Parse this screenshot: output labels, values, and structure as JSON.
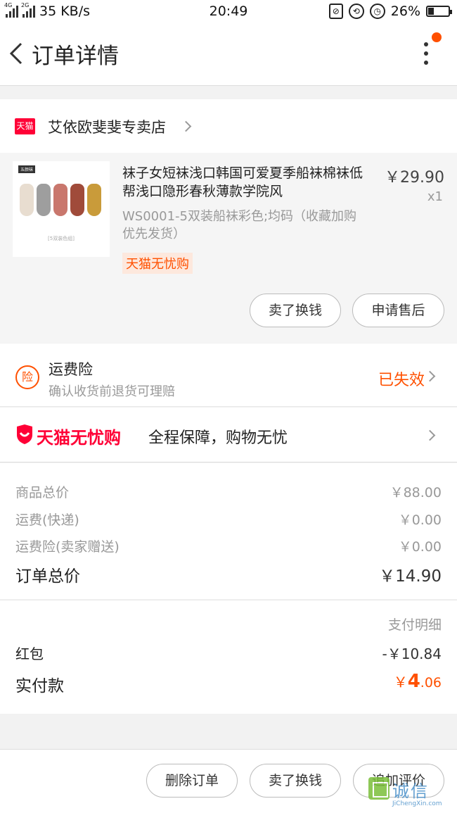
{
  "status_bar": {
    "network_speed": "35 KB/s",
    "net1": "4G",
    "net2": "2G",
    "time": "20:49",
    "battery": "26%",
    "battery_level": 0.26,
    "icons": [
      "mute-icon",
      "rotation-lock-icon",
      "alarm-icon",
      "battery-icon"
    ]
  },
  "nav": {
    "title": "订单详情",
    "back_icon": "chevron-left-icon",
    "more_icon": "more-vertical-icon",
    "notification_dot_color": "#ff5000"
  },
  "store": {
    "badge": "天猫",
    "name": "艾依欧斐斐专卖店"
  },
  "product": {
    "title": "袜子女短袜浅口韩国可爱夏季船袜棉袜低帮浅口隐形春秋薄款学院风",
    "sku": "WS0001-5双装船袜彩色;均码（收藏加购优先发货）",
    "tag": "天猫无忧购",
    "price": "￥29.90",
    "quantity": "x1",
    "thumb_label": "五颜袜",
    "thumb_caption": "[5双装色组]",
    "sock_colors": [
      "#e8ddd0",
      "#9e9e9e",
      "#c9776d",
      "#a04b3a",
      "#c99b3a"
    ]
  },
  "product_actions": {
    "resell": "卖了换钱",
    "after_sale": "申请售后"
  },
  "insurance": {
    "icon_text": "险",
    "title": "运费险",
    "desc": "确认收货前退货可理赔",
    "status": "已失效"
  },
  "worry_free": {
    "brand": "天猫无忧购",
    "slogan": "全程保障，购物无忧"
  },
  "summary": {
    "goods_total_label": "商品总价",
    "goods_total": "￥88.00",
    "shipping_label": "运费(快递)",
    "shipping": "￥0.00",
    "shipping_ins_label": "运费险(卖家赠送)",
    "shipping_ins": "￥0.00",
    "order_total_label": "订单总价",
    "order_total": "￥14.90"
  },
  "payment": {
    "detail_link": "支付明细",
    "red_packet_label": "红包",
    "red_packet": "-￥10.84",
    "paid_label": "实付款",
    "paid_currency": "￥",
    "paid_int": "4",
    "paid_dec": ".06"
  },
  "footer": {
    "delete": "删除订单",
    "resell": "卖了换钱",
    "review": "追加评价"
  },
  "watermark": {
    "cn": "诚信",
    "en": "JiChengXin.com"
  },
  "colors": {
    "accent": "#ff5000",
    "tmall_red": "#ff0036"
  }
}
